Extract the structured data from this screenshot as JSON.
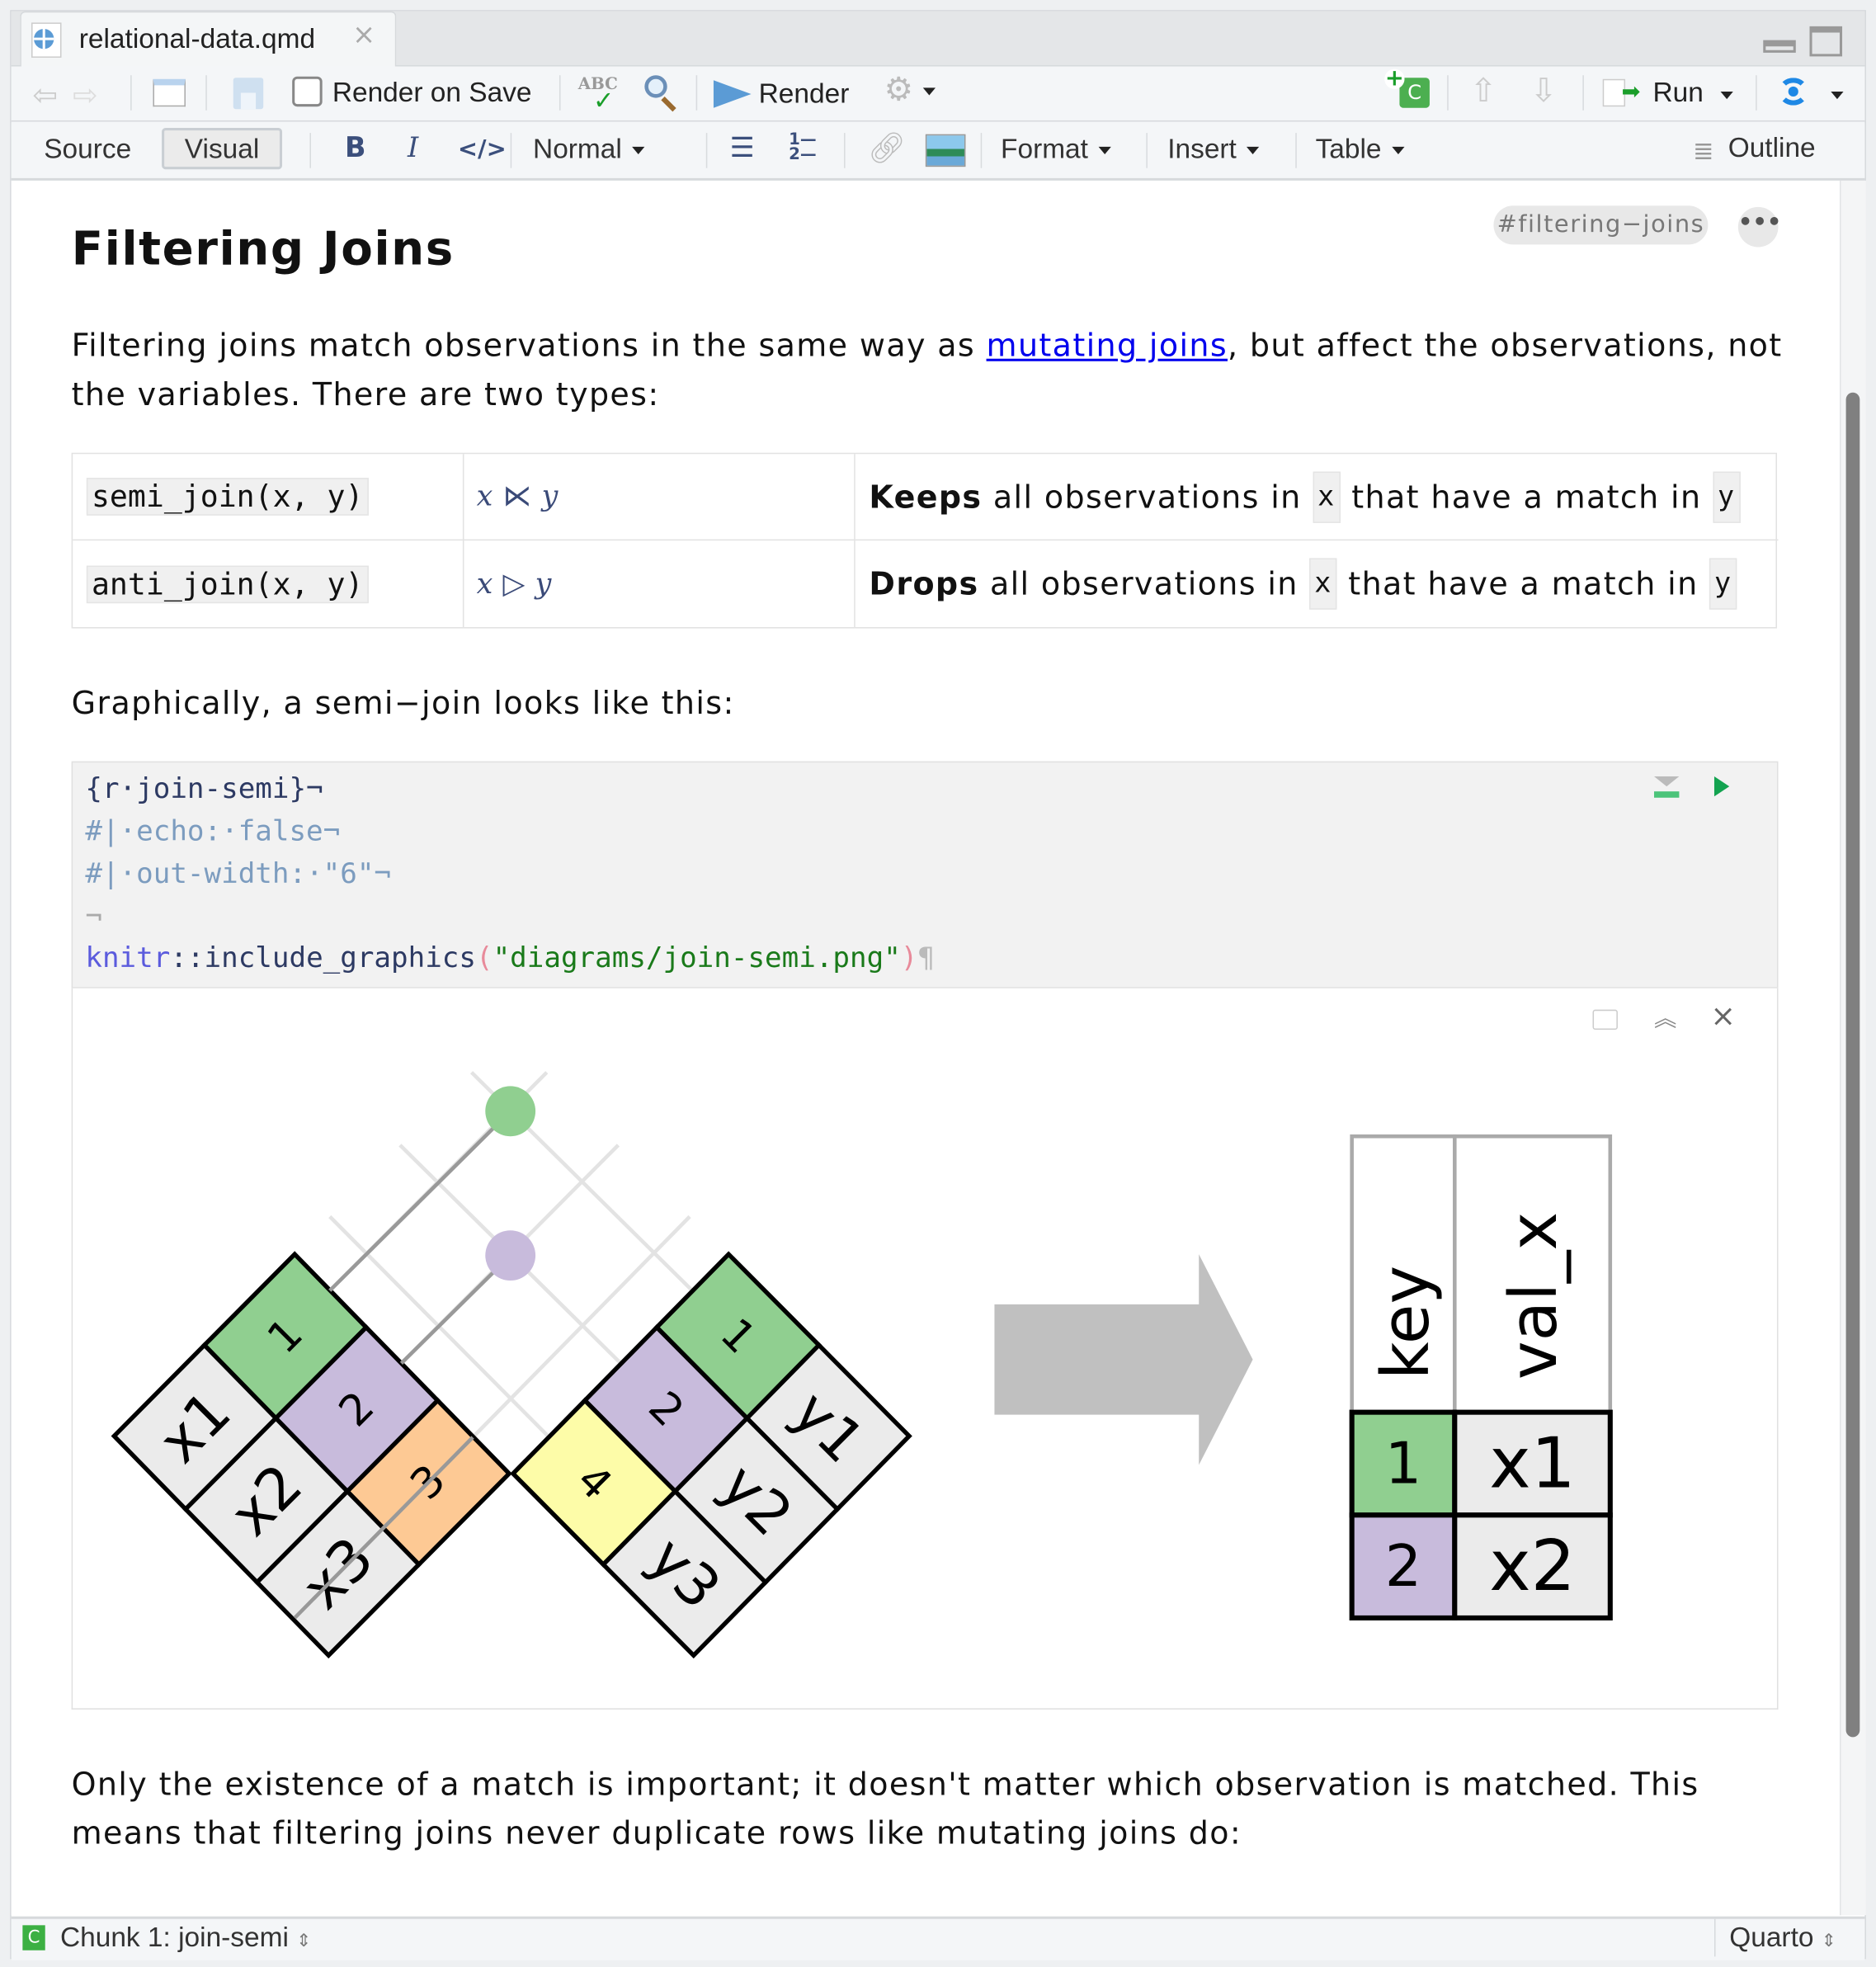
{
  "tab": {
    "filename": "relational-data.qmd",
    "close": "×"
  },
  "toolbar": {
    "render_on_save": "Render on Save",
    "render_on_save_checked": false,
    "spell_abc": "ABC",
    "render": "Render",
    "run": "Run",
    "insert_chunk_letter": "C"
  },
  "format_bar": {
    "source": "Source",
    "visual": "Visual",
    "bold": "B",
    "italic": "I",
    "code": "</>",
    "style": "Normal",
    "format": "Format",
    "insert": "Insert",
    "table": "Table",
    "outline": "Outline"
  },
  "doc": {
    "heading": "Filtering Joins",
    "heading_anchor": "#filtering−joins",
    "more": "•••",
    "para1_before": "Filtering joins match observations in the same way as ",
    "para1_link": "mutating joins",
    "para1_after": ", but affect the observations, not the variables. There are two types:",
    "table": [
      {
        "fn": "semi_join(x, y)",
        "math_x": "x",
        "math_op": "⋉",
        "math_y": "y",
        "bold": "Keeps",
        "text": " all observations in ",
        "x": "x",
        "text2": " that have a match in ",
        "y": "y"
      },
      {
        "fn": "anti_join(x, y)",
        "math_x": "x",
        "math_op": "▷",
        "math_y": "y",
        "bold": "Drops",
        "text": " all observations in ",
        "x": "x",
        "text2": " that have a match in ",
        "y": "y"
      }
    ],
    "para2": "Graphically, a semi−join looks like this:",
    "code": {
      "line1": "{r·join-semi}¬",
      "line2": "#|·echo:·false¬",
      "line3": "#|·out-width:·\"6\"¬",
      "line4": "¬",
      "line5_ns": "knitr",
      "line5_op": "::",
      "line5_fn": "include_graphics",
      "line5_lp": "(",
      "line5_str": "\"diagrams/join-semi.png\"",
      "line5_rp": ")",
      "line5_pilcrow": "¶"
    },
    "output_close": "×",
    "para3": "Only the existence of a match is important; it doesn't matter which observation is matched. This means that filtering joins never duplicate rows like mutating joins do:"
  },
  "diagram": {
    "colors": {
      "green": "#90cf90",
      "purple": "#c8bbdc",
      "orange": "#fdc994",
      "yellow": "#fdfca8",
      "gray": "#ebebeb",
      "arrow": "#c0c0c0"
    },
    "left_keys": [
      "1",
      "2",
      "3"
    ],
    "left_vals": [
      "x1",
      "x2",
      "x3"
    ],
    "right_keys": [
      "1",
      "2",
      "4"
    ],
    "right_vals": [
      "y1",
      "y2",
      "y3"
    ],
    "result": {
      "headers": [
        "key",
        "val_x"
      ],
      "rows": [
        [
          "1",
          "x1"
        ],
        [
          "2",
          "x2"
        ]
      ]
    }
  },
  "status": {
    "chunk_letter": "C",
    "chunk": "Chunk 1: join-semi",
    "mode": "Quarto",
    "accent": "#3cb043"
  }
}
